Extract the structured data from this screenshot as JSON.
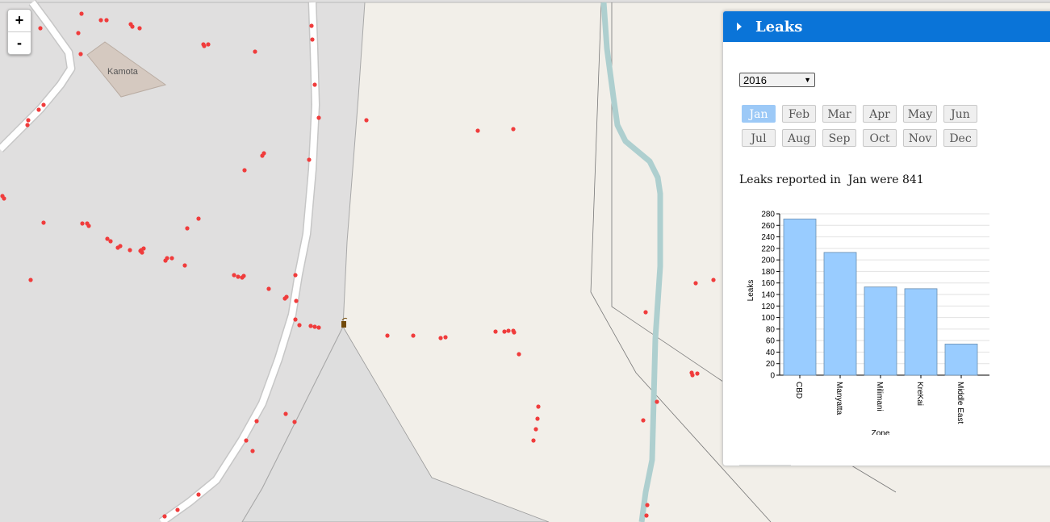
{
  "map": {
    "place_label": "Kamota",
    "zoom_in_label": "+",
    "zoom_out_label": "-",
    "leak_color": "#f03c3c"
  },
  "panel": {
    "title": "Leaks",
    "year": "2016",
    "months": [
      "Jan",
      "Feb",
      "Mar",
      "Apr",
      "May",
      "Jun",
      "Jul",
      "Aug",
      "Sep",
      "Oct",
      "Nov",
      "Dec"
    ],
    "selected_month": "Jan",
    "summary": "Leaks reported in  Jan were 841"
  },
  "chart_data": {
    "type": "bar",
    "categories": [
      "CBD",
      "Manyatta",
      "Milimani",
      "KreKai",
      "Middle East"
    ],
    "values": [
      271,
      213,
      153,
      150,
      54
    ],
    "xlabel": "Zone",
    "ylabel": "Leaks",
    "ylim": [
      0,
      280
    ],
    "yticks": [
      0,
      20,
      40,
      60,
      80,
      100,
      120,
      140,
      160,
      180,
      200,
      220,
      240,
      260,
      280
    ],
    "bar_color": "#99ccff",
    "grid": true
  }
}
